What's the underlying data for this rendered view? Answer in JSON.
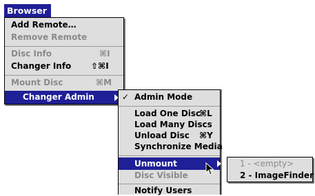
{
  "menubar": {
    "title": "Browser"
  },
  "browser_menu": {
    "add_remote": "Add Remote…",
    "remove_remote": "Remove Remote",
    "disc_info": "Disc Info",
    "disc_info_shortcut": "⌘I",
    "changer_info": "Changer Info",
    "changer_info_shortcut": "⇧⌘I",
    "mount_disc": "Mount Disc",
    "mount_disc_shortcut": "⌘M",
    "changer_admin": "Changer Admin"
  },
  "changer_admin_menu": {
    "checkmark": "✓",
    "admin_mode": "Admin Mode",
    "load_one_disc": "Load One Disc",
    "load_one_disc_shortcut": "⌘L",
    "load_many_discs": "Load Many Discs",
    "unload_disc": "Unload Disc",
    "unload_disc_shortcut": "⌘Y",
    "synchronize_media": "Synchronize Media",
    "unmount": "Unmount",
    "disc_visible": "Disc Visible",
    "notify_users": "Notify Users"
  },
  "unmount_menu": {
    "item1": "1 - <empty>",
    "item2": "2 - ImageFinder"
  },
  "colors": {
    "highlight": "#1f1f97",
    "menu_bg": "#dedede",
    "disabled": "#8a8a8a"
  }
}
